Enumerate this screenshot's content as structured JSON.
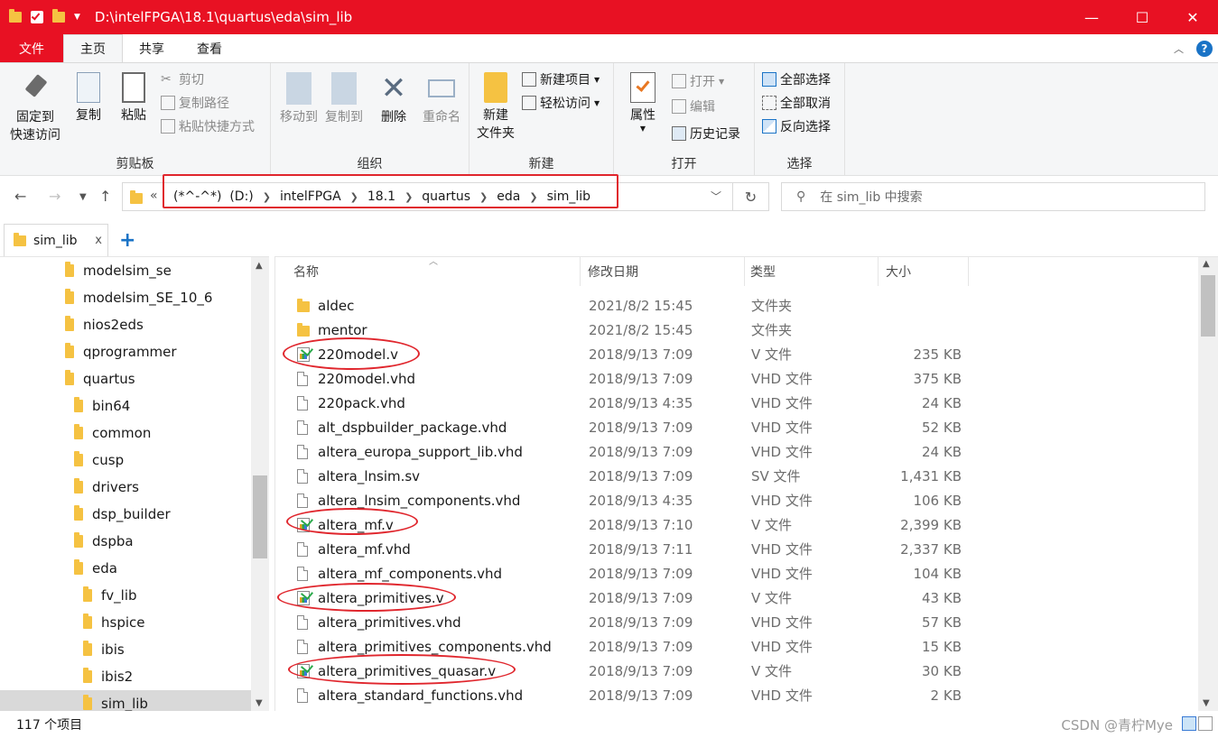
{
  "window": {
    "title": "D:\\intelFPGA\\18.1\\quartus\\eda\\sim_lib",
    "buttons": {
      "minimize": "—",
      "maximize": "☐",
      "close": "✕"
    }
  },
  "ribbon_tabs": [
    "文件",
    "主页",
    "共享",
    "查看"
  ],
  "ribbon": {
    "clipboard": {
      "label": "剪贴板",
      "pin": "固定到\n快速访问",
      "pin_line1": "固定到",
      "pin_line2": "快速访问",
      "copy": "复制",
      "paste": "粘贴",
      "cut": "剪切",
      "copy_path": "复制路径",
      "paste_shortcut": "粘贴快捷方式"
    },
    "organize": {
      "label": "组织",
      "move_to": "移动到",
      "copy_to": "复制到",
      "delete": "删除",
      "rename": "重命名"
    },
    "new": {
      "label": "新建",
      "new_folder_line1": "新建",
      "new_folder_line2": "文件夹",
      "new_item": "新建项目",
      "easy_access": "轻松访问"
    },
    "open": {
      "label": "打开",
      "properties": "属性",
      "open": "打开",
      "edit": "编辑",
      "history": "历史记录"
    },
    "select": {
      "label": "选择",
      "select_all": "全部选择",
      "select_none": "全部取消",
      "invert": "反向选择"
    }
  },
  "address": {
    "crumbs": [
      "(*^-^*)  (D:)",
      "intelFPGA",
      "18.1",
      "quartus",
      "eda",
      "sim_lib"
    ],
    "overflow": "«",
    "search_placeholder": "在 sim_lib 中搜索"
  },
  "doc_tab": {
    "label": "sim_lib",
    "close": "x",
    "add": "+"
  },
  "tree": [
    {
      "label": "modelsim_se",
      "indent": 1
    },
    {
      "label": "modelsim_SE_10_6",
      "indent": 1
    },
    {
      "label": "nios2eds",
      "indent": 1
    },
    {
      "label": "qprogrammer",
      "indent": 1
    },
    {
      "label": "quartus",
      "indent": 1
    },
    {
      "label": "bin64",
      "indent": 2
    },
    {
      "label": "common",
      "indent": 2
    },
    {
      "label": "cusp",
      "indent": 2
    },
    {
      "label": "drivers",
      "indent": 2
    },
    {
      "label": "dsp_builder",
      "indent": 2
    },
    {
      "label": "dspba",
      "indent": 2
    },
    {
      "label": "eda",
      "indent": 2
    },
    {
      "label": "fv_lib",
      "indent": 3
    },
    {
      "label": "hspice",
      "indent": 3
    },
    {
      "label": "ibis",
      "indent": 3
    },
    {
      "label": "ibis2",
      "indent": 3
    },
    {
      "label": "sim_lib",
      "indent": 3,
      "selected": true
    }
  ],
  "columns": {
    "name": "名称",
    "date": "修改日期",
    "type": "类型",
    "size": "大小"
  },
  "files": [
    {
      "name": "aldec",
      "date": "2021/8/2 15:45",
      "type": "文件夹",
      "size": "",
      "icon": "folder-icon"
    },
    {
      "name": "mentor",
      "date": "2021/8/2 15:45",
      "type": "文件夹",
      "size": "",
      "icon": "folder-icon"
    },
    {
      "name": "220model.v",
      "date": "2018/9/13 7:09",
      "type": "V 文件",
      "size": "235 KB",
      "icon": "verilog-file-icon"
    },
    {
      "name": "220model.vhd",
      "date": "2018/9/13 7:09",
      "type": "VHD 文件",
      "size": "375 KB",
      "icon": "file-icon"
    },
    {
      "name": "220pack.vhd",
      "date": "2018/9/13 4:35",
      "type": "VHD 文件",
      "size": "24 KB",
      "icon": "file-icon"
    },
    {
      "name": "alt_dspbuilder_package.vhd",
      "date": "2018/9/13 7:09",
      "type": "VHD 文件",
      "size": "52 KB",
      "icon": "file-icon"
    },
    {
      "name": "altera_europa_support_lib.vhd",
      "date": "2018/9/13 7:09",
      "type": "VHD 文件",
      "size": "24 KB",
      "icon": "file-icon"
    },
    {
      "name": "altera_lnsim.sv",
      "date": "2018/9/13 7:09",
      "type": "SV 文件",
      "size": "1,431 KB",
      "icon": "file-icon"
    },
    {
      "name": "altera_lnsim_components.vhd",
      "date": "2018/9/13 4:35",
      "type": "VHD 文件",
      "size": "106 KB",
      "icon": "file-icon"
    },
    {
      "name": "altera_mf.v",
      "date": "2018/9/13 7:10",
      "type": "V 文件",
      "size": "2,399 KB",
      "icon": "verilog-file-icon"
    },
    {
      "name": "altera_mf.vhd",
      "date": "2018/9/13 7:11",
      "type": "VHD 文件",
      "size": "2,337 KB",
      "icon": "file-icon"
    },
    {
      "name": "altera_mf_components.vhd",
      "date": "2018/9/13 7:09",
      "type": "VHD 文件",
      "size": "104 KB",
      "icon": "file-icon"
    },
    {
      "name": "altera_primitives.v",
      "date": "2018/9/13 7:09",
      "type": "V 文件",
      "size": "43 KB",
      "icon": "verilog-file-icon"
    },
    {
      "name": "altera_primitives.vhd",
      "date": "2018/9/13 7:09",
      "type": "VHD 文件",
      "size": "57 KB",
      "icon": "file-icon"
    },
    {
      "name": "altera_primitives_components.vhd",
      "date": "2018/9/13 7:09",
      "type": "VHD 文件",
      "size": "15 KB",
      "icon": "file-icon"
    },
    {
      "name": "altera_primitives_quasar.v",
      "date": "2018/9/13 7:09",
      "type": "V 文件",
      "size": "30 KB",
      "icon": "verilog-file-icon"
    },
    {
      "name": "altera_standard_functions.vhd",
      "date": "2018/9/13 7:09",
      "type": "VHD 文件",
      "size": "2 KB",
      "icon": "file-icon"
    }
  ],
  "status": {
    "count": "117 个项目",
    "watermark": "CSDN @青柠Mye"
  },
  "colors": {
    "titlebar": "#e81123",
    "annotation": "#e0262d",
    "accent": "#1a73c6",
    "folder": "#f5c242"
  }
}
